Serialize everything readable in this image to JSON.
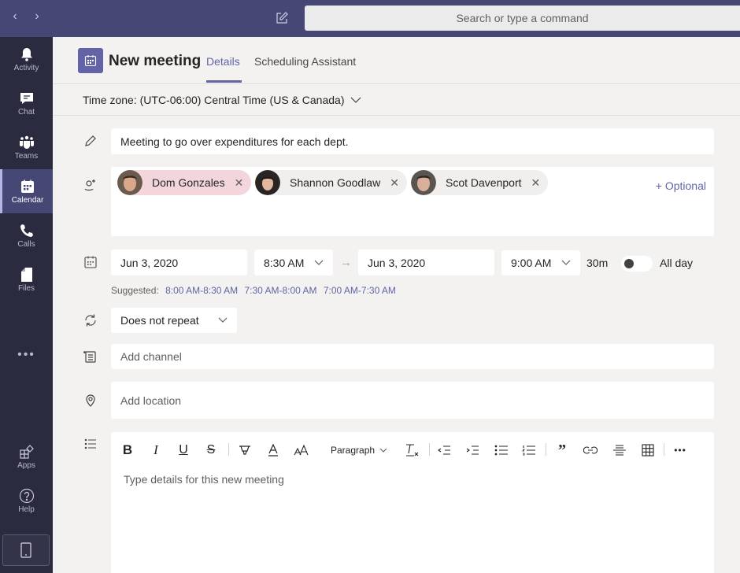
{
  "topbar": {
    "back_icon": "chevron-left-icon",
    "forward_icon": "chevron-right-icon",
    "compose_icon": "compose-icon",
    "search_placeholder": "Search or type a command"
  },
  "rail": {
    "items": [
      {
        "label": "Activity",
        "icon": "bell-icon",
        "active": false
      },
      {
        "label": "Chat",
        "icon": "chat-icon",
        "active": false
      },
      {
        "label": "Teams",
        "icon": "teams-icon",
        "active": false
      },
      {
        "label": "Calendar",
        "icon": "calendar-icon",
        "active": true
      },
      {
        "label": "Calls",
        "icon": "phone-icon",
        "active": false
      },
      {
        "label": "Files",
        "icon": "file-icon",
        "active": false
      }
    ],
    "more": "•••",
    "bottom": [
      {
        "label": "Apps",
        "icon": "apps-icon"
      },
      {
        "label": "Help",
        "icon": "help-icon"
      }
    ],
    "device_icon": "mobile-device-icon"
  },
  "header": {
    "title": "New meeting",
    "tabs": [
      {
        "label": "Details",
        "active": true
      },
      {
        "label": "Scheduling Assistant",
        "active": false
      }
    ]
  },
  "timezone": {
    "label": "Time zone: (UTC-06:00) Central Time (US & Canada)"
  },
  "form": {
    "title_value": "Meeting to go over expenditures for each dept.",
    "attendees": [
      {
        "name": "Dom Gonzales",
        "highlighted": true
      },
      {
        "name": "Shannon Goodlaw",
        "highlighted": false
      },
      {
        "name": "Scot Davenport",
        "highlighted": false
      }
    ],
    "remove_glyph": "✕",
    "optional_label": "+ Optional",
    "start_date": "Jun 3, 2020",
    "start_time": "8:30 AM",
    "end_date": "Jun 3, 2020",
    "end_time": "9:00 AM",
    "arrow": "→",
    "duration": "30m",
    "allday_label": "All day",
    "allday_on": false,
    "suggested_label": "Suggested:",
    "suggestions": [
      "8:00 AM-8:30 AM",
      "7:30 AM-8:00 AM",
      "7:00 AM-7:30 AM"
    ],
    "repeat_value": "Does not repeat",
    "channel_placeholder": "Add channel",
    "location_placeholder": "Add location",
    "details_placeholder": "Type details for this new meeting"
  },
  "toolbar": {
    "bold": "B",
    "italic": "I",
    "underline": "U",
    "strike": "S",
    "paragraph_label": "Paragraph",
    "more": "•••"
  },
  "colors": {
    "brand": "#6264a7",
    "topbar": "#464775",
    "rail": "#2b2b40",
    "chip_highlight": "#f3d6dc"
  }
}
